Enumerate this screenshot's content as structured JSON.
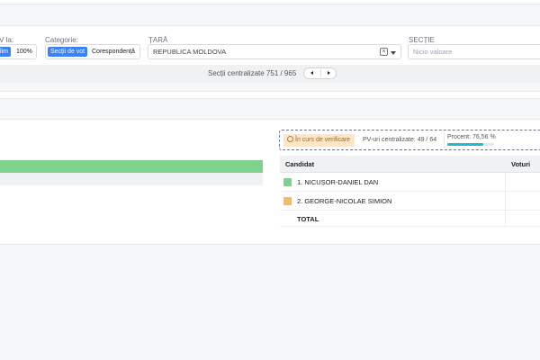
{
  "filters": {
    "pv_label": "V la:",
    "pv_options": [
      "lim",
      "100%"
    ],
    "category_label": "Categorie:",
    "category_options": [
      "Secții de vot",
      "Corespondență"
    ],
    "country_label": "ȚARĂ",
    "country_value": "REPUBLICA MOLDOVA",
    "section_label": "SECȚIE",
    "section_placeholder": "Nicio valoare"
  },
  "pager": {
    "counter_text": "Secții centralizate 751 / 965"
  },
  "bar_chart": {
    "candidate1_share": 1.0,
    "candidate1_color": "#7fd18e",
    "candidate2_share": 0.0
  },
  "status": {
    "badge": "În curs de verificare",
    "pv_centralized": "PV-uri centralizate: 49 / 64",
    "percent_text": "Procent: 76,56 %",
    "percent_value": 76.56
  },
  "table": {
    "headers": [
      "Candidat",
      "Voturi"
    ],
    "rows": [
      {
        "name": "1. NICUȘOR-DANIEL DAN",
        "color": "#7fd18e"
      },
      {
        "name": "2. GEORGE-NICOLAE SIMION",
        "color": "#f7b860"
      }
    ],
    "total_label": "TOTAL"
  }
}
